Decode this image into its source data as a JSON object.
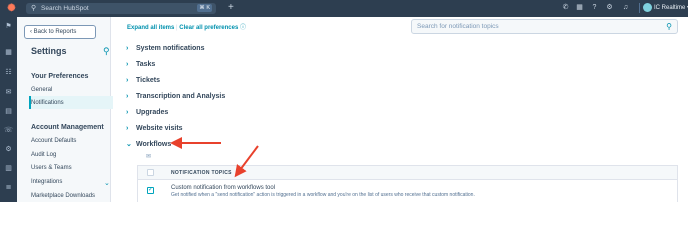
{
  "topbar": {
    "search_placeholder": "Search HubSpot",
    "search_shortcut": "⌘ K",
    "account_name": "IC Realtime",
    "accent_color": "#2d3e50",
    "icons": [
      "phone-icon",
      "marketplace-icon",
      "help-icon",
      "settings-icon",
      "notifications-icon"
    ]
  },
  "sidebar": {
    "back_label": "Back to Reports",
    "title": "Settings",
    "sections": [
      {
        "heading": "Your Preferences",
        "items": [
          "General",
          "Notifications"
        ]
      },
      {
        "heading": "Account Management",
        "items": [
          "Account Defaults",
          "Audit Log",
          "Users & Teams",
          "Integrations",
          "Marketplace Downloads"
        ]
      }
    ],
    "active_item": "Notifications"
  },
  "main": {
    "expand_all": "Expand all items",
    "divider": "|",
    "clear_all": "Clear all preferences",
    "search_placeholder": "Search for notification topics",
    "sections": [
      "System notifications",
      "Tasks",
      "Tickets",
      "Transcription and Analysis",
      "Upgrades",
      "Website visits",
      "Workflows"
    ],
    "expanded_section": "Workflows",
    "table": {
      "header": "NOTIFICATION TOPICS",
      "rows": [
        {
          "name": "Custom notification from workflows tool",
          "description": "Get notified when a \"send notification\" action is triggered in a workflow and you're on the list of users who receive that custom notification.",
          "checked": true
        }
      ]
    }
  },
  "annotation_color": "#e8412c"
}
